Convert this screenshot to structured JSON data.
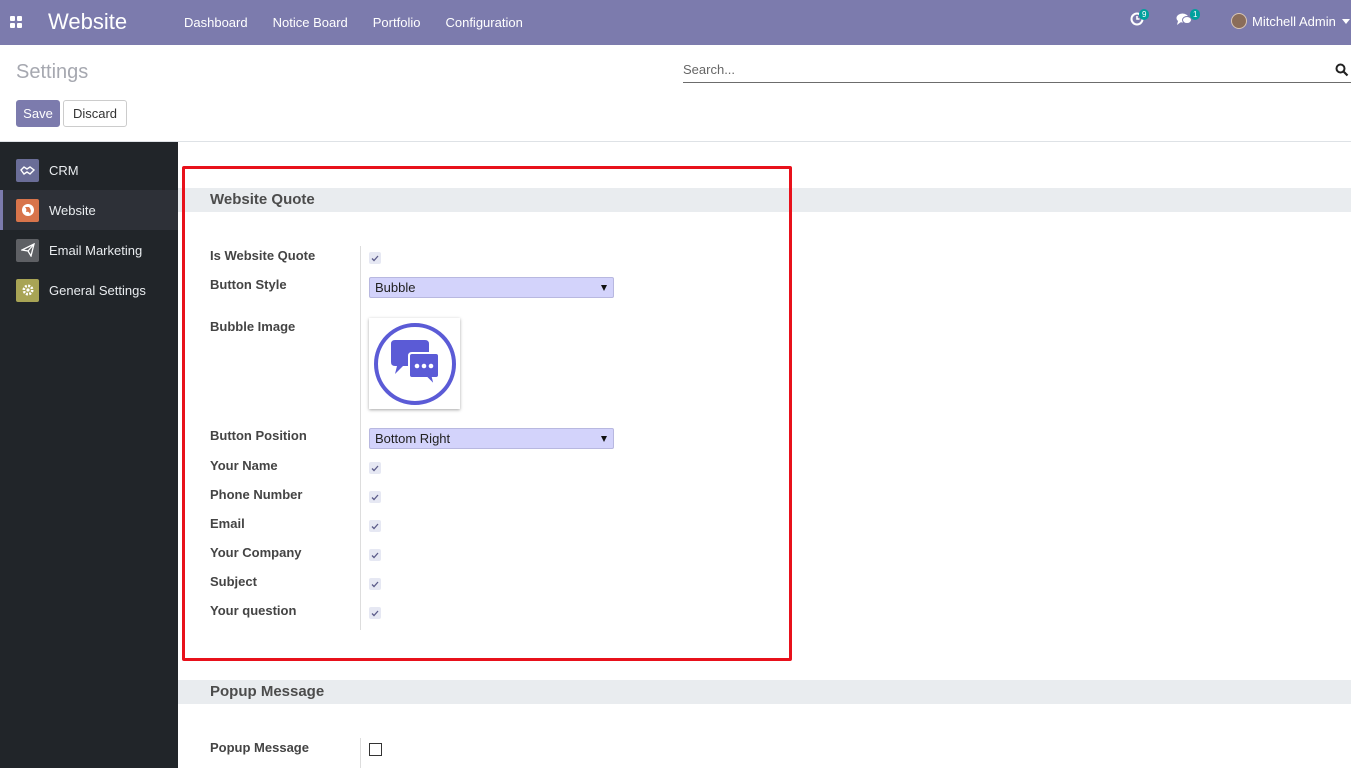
{
  "navbar": {
    "brand": "Website",
    "menu": [
      "Dashboard",
      "Notice Board",
      "Portfolio",
      "Configuration"
    ],
    "activity_count": "9",
    "message_count": "1",
    "user_name": "Mitchell Admin",
    "bg_color": "#7c7bad"
  },
  "control_panel": {
    "title": "Settings",
    "search_placeholder": "Search...",
    "save_label": "Save",
    "discard_label": "Discard"
  },
  "sidebar": {
    "items": [
      {
        "label": "CRM",
        "icon": "handshake-icon",
        "color": "#6a6d97"
      },
      {
        "label": "Website",
        "icon": "globe-icon",
        "color": "#d8744b"
      },
      {
        "label": "Email Marketing",
        "icon": "paper-plane-icon",
        "color": "#5e6064"
      },
      {
        "label": "General Settings",
        "icon": "gear-icon",
        "color": "#a8a455"
      }
    ],
    "active": "Website"
  },
  "website_quote": {
    "heading": "Website Quote",
    "is_website_quote_label": "Is Website Quote",
    "is_website_quote": true,
    "button_style_label": "Button Style",
    "button_style": "Bubble",
    "bubble_image_label": "Bubble Image",
    "bubble_image_icon": "chat-bubbles-icon",
    "button_position_label": "Button Position",
    "button_position": "Bottom Right",
    "checkbox_fields": [
      {
        "label": "Your Name",
        "checked": true
      },
      {
        "label": "Phone Number",
        "checked": true
      },
      {
        "label": "Email",
        "checked": true
      },
      {
        "label": "Your Company",
        "checked": true
      },
      {
        "label": "Subject",
        "checked": true
      },
      {
        "label": "Your question",
        "checked": true
      }
    ]
  },
  "popup_message": {
    "heading": "Popup Message",
    "popup_message_label": "Popup Message",
    "popup_message": false
  },
  "highlight_color": "#e8111b"
}
